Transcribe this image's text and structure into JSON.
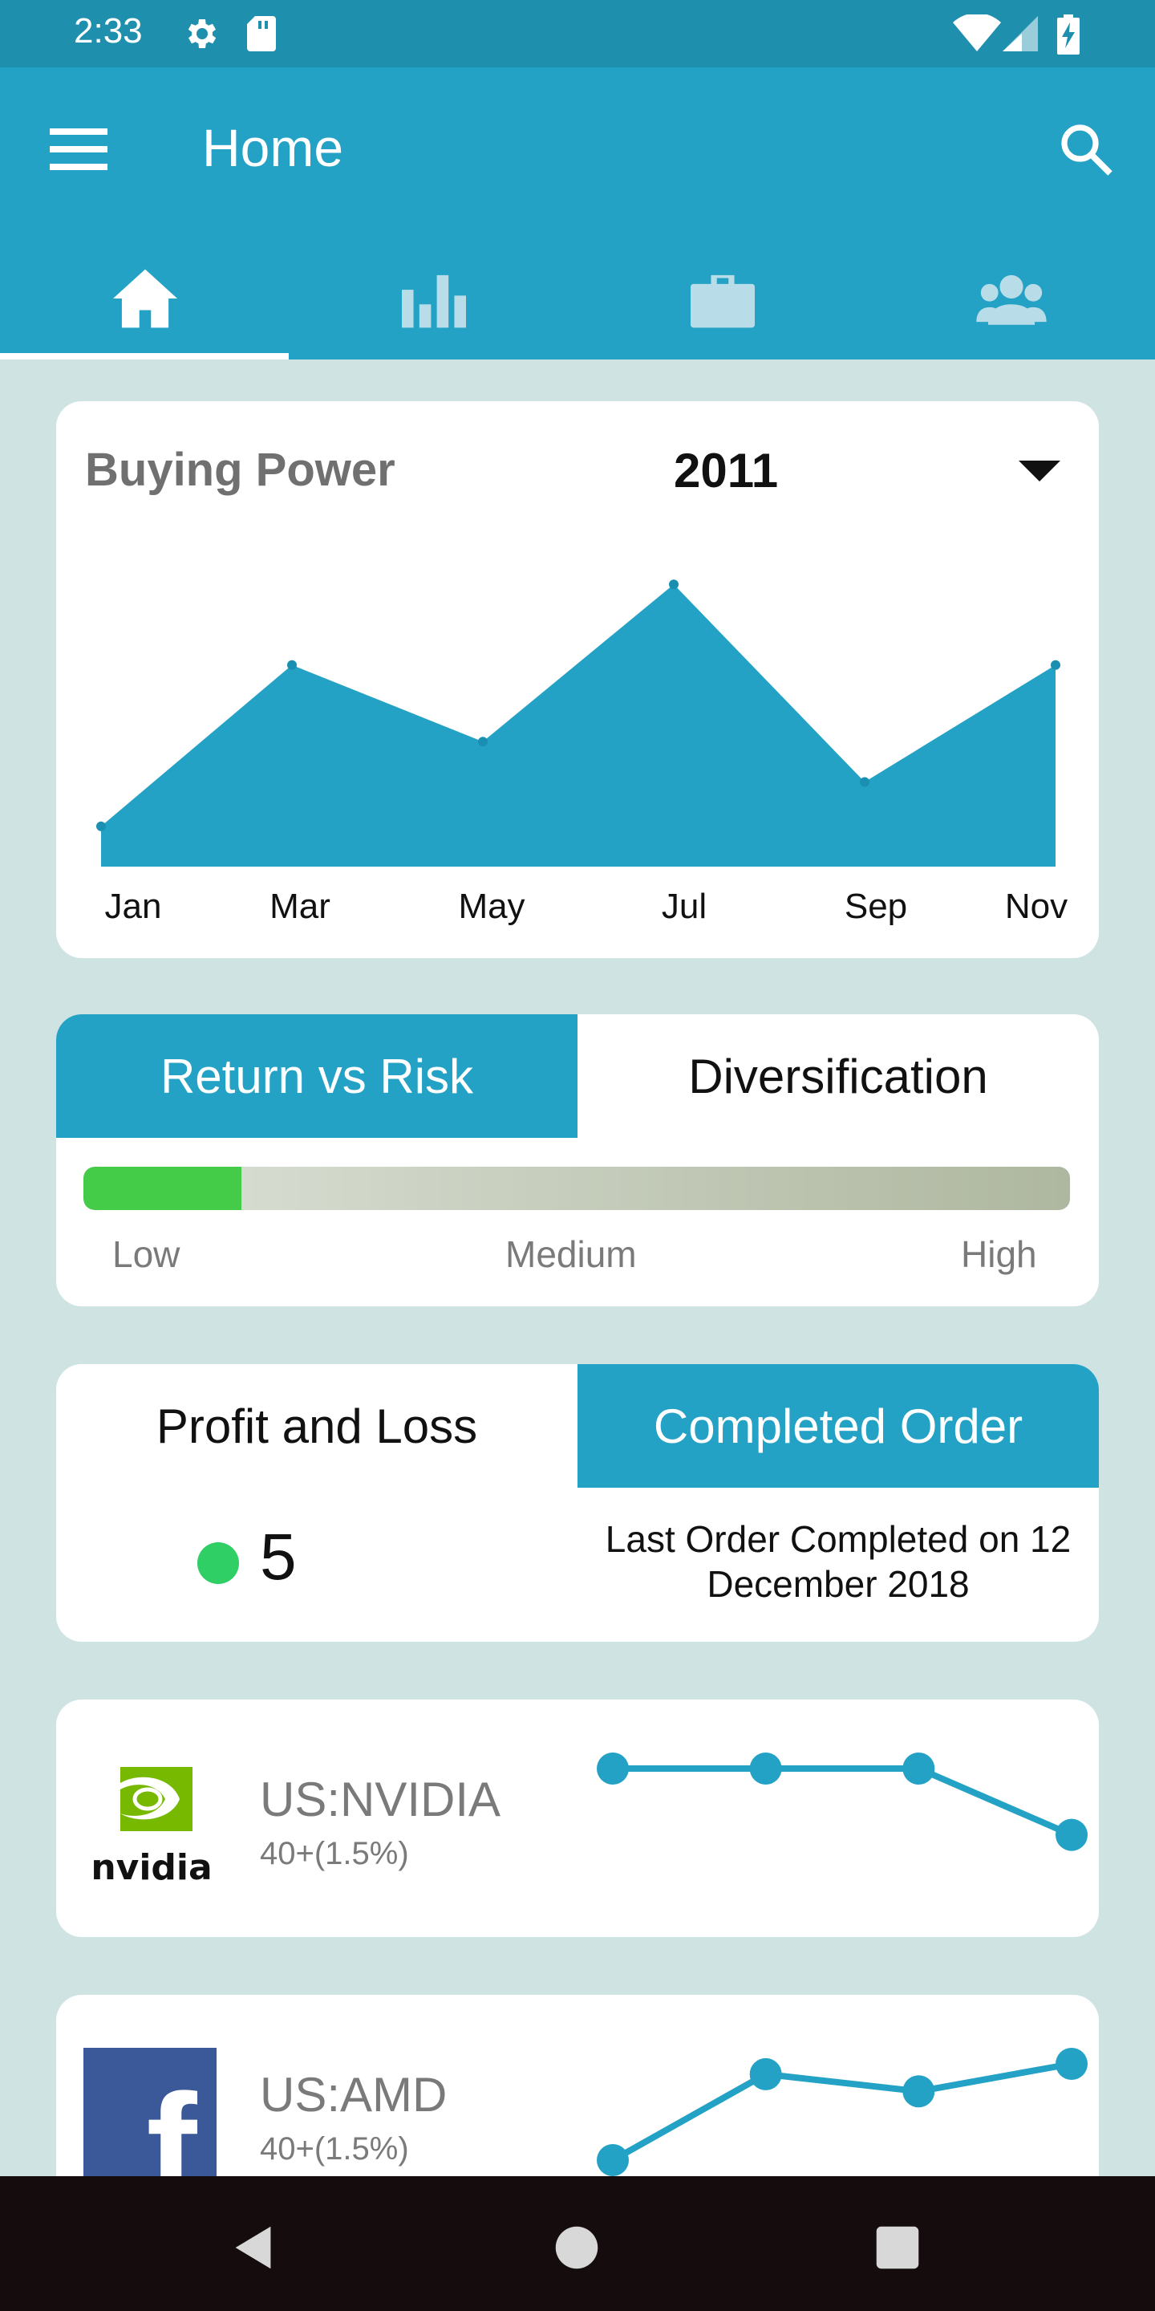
{
  "status_bar": {
    "time": "2:33"
  },
  "app_bar": {
    "title": "Home"
  },
  "tabs": [
    {
      "icon": "home-icon",
      "active": true
    },
    {
      "icon": "bar-chart-icon",
      "active": false
    },
    {
      "icon": "briefcase-icon",
      "active": false
    },
    {
      "icon": "people-icon",
      "active": false
    }
  ],
  "buying_power": {
    "title": "Buying Power",
    "year": "2011",
    "chart_data": {
      "type": "area",
      "categories": [
        "Jan",
        "Mar",
        "May",
        "Jul",
        "Sep",
        "Nov"
      ],
      "series": [
        {
          "values": [
            10,
            50,
            31,
            70,
            21,
            50
          ]
        }
      ],
      "x_labels": [
        "Jan",
        "Mar",
        "May",
        "Jul",
        "Sep",
        "Nov"
      ],
      "grid": false,
      "color": "#23a2c6"
    }
  },
  "risk_card": {
    "tabs": [
      "Return vs Risk",
      "Diversification"
    ],
    "active_tab": 0,
    "level_fraction": 0.16,
    "labels": {
      "low": "Low",
      "medium": "Medium",
      "high": "High"
    }
  },
  "orders_card": {
    "tabs": [
      "Profit and Loss",
      "Completed Order"
    ],
    "active_tab": 1,
    "count": "5",
    "last_order_text": "Last Order Completed on 12 December 2018"
  },
  "stocks": [
    {
      "name": "US:NVIDIA",
      "change": "40+(1.5%)",
      "logo": "nvidia-logo",
      "logo_text": "nvidia",
      "trend": [
        3,
        3,
        3,
        1
      ]
    },
    {
      "name": "US:AMD",
      "change": "40+(1.5%)",
      "logo": "facebook-logo",
      "logo_text": "f",
      "trend": [
        0,
        2.5,
        2,
        2.8
      ]
    }
  ],
  "colors": {
    "accent": "#23a2c6",
    "status_bar": "#1f8fae",
    "background": "#cfe3e3",
    "green": "#44cc49"
  }
}
